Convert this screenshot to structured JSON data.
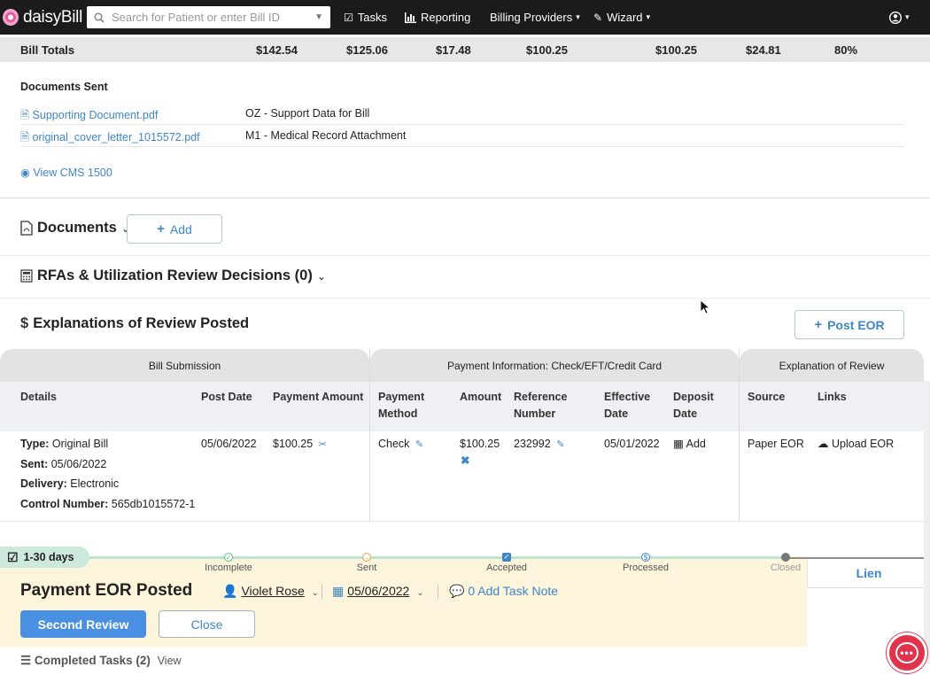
{
  "nav": {
    "logo": "daisyBill",
    "search_placeholder": "Search for Patient or enter Bill ID",
    "tasks": "Tasks",
    "reporting": "Reporting",
    "billing_providers": "Billing Providers",
    "wizard": "Wizard"
  },
  "totals": {
    "label": "Bill Totals",
    "values": [
      "$142.54",
      "$125.06",
      "$17.48",
      "$100.25",
      "$100.25",
      "$24.81",
      "80%"
    ]
  },
  "documents_sent": {
    "title": "Documents Sent",
    "rows": [
      {
        "file": "Supporting Document.pdf",
        "desc": "OZ - Support Data for Bill"
      },
      {
        "file": "original_cover_letter_1015572.pdf",
        "desc": "M1 - Medical Record Attachment"
      }
    ],
    "view_cms": "View CMS 1500"
  },
  "documents": {
    "title": "Documents",
    "add_label": "Add"
  },
  "rfas": {
    "title": "RFAs & Utilization Review Decisions (0)"
  },
  "eor": {
    "title": "Explanations of Review Posted",
    "post_label": "Post EOR",
    "groups": [
      "Bill Submission",
      "Payment Information: Check/EFT/Credit Card",
      "Explanation of Review"
    ],
    "headers": {
      "details": "Details",
      "post_date": "Post Date",
      "payment_amount": "Payment Amount",
      "payment_method": [
        "Payment",
        "Method"
      ],
      "amount": "Amount",
      "reference_number": [
        "Reference",
        "Number"
      ],
      "effective_date": [
        "Effective",
        "Date"
      ],
      "deposit_date": [
        "Deposit",
        "Date"
      ],
      "source": "Source",
      "links": "Links"
    },
    "row": {
      "type_label": "Type:",
      "type_value": "Original Bill",
      "sent_label": "Sent:",
      "sent_value": "05/06/2022",
      "delivery_label": "Delivery:",
      "delivery_value": "Electronic",
      "control_label": "Control Number:",
      "control_value": "565db1015572-1",
      "post_date": "05/06/2022",
      "payment_amount": "$100.25",
      "payment_method": "Check",
      "amount": "$100.25",
      "reference_number": "232992",
      "effective_date": "05/01/2022",
      "deposit_add": "Add",
      "source": "Paper EOR",
      "upload": "Upload EOR"
    }
  },
  "task": {
    "badge": "1-30 days",
    "steps": [
      "Incomplete",
      "Sent",
      "Accepted",
      "Processed",
      "Closed"
    ],
    "title": "Payment EOR Posted",
    "assignee": "Violet Rose",
    "date": "05/06/2022",
    "note": "0 Add Task Note",
    "primary": "Second Review",
    "close": "Close",
    "lien": "Lien",
    "completed": "Completed Tasks (2)",
    "view": "View"
  },
  "colors": {
    "accent": "#3f86c9",
    "primary_button": "#4a90e2",
    "task_bg": "#fdf4dc",
    "chat": "#e0334c"
  }
}
